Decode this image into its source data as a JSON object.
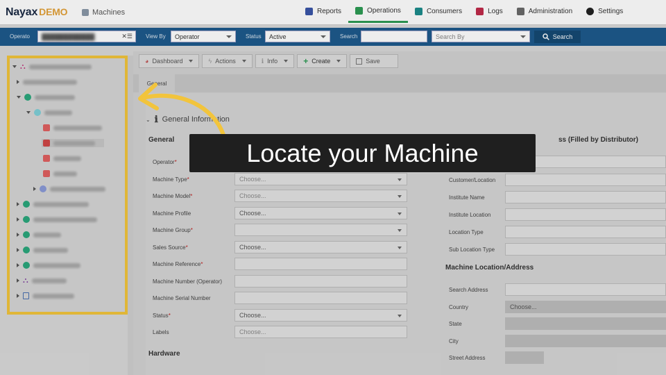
{
  "app": {
    "logo_main": "Nayax",
    "logo_sub": "DEMO",
    "page": "Machines"
  },
  "nav": [
    {
      "label": "Reports",
      "color": "#3a55a8"
    },
    {
      "label": "Operations",
      "color": "#2e9b54",
      "active": true
    },
    {
      "label": "Consumers",
      "color": "#1d8c8c"
    },
    {
      "label": "Logs",
      "color": "#c02a4a"
    },
    {
      "label": "Administration",
      "color": "#6a6a6a"
    },
    {
      "label": "Settings",
      "color": "#222222"
    }
  ],
  "filters": {
    "operator_label": "Operato",
    "view_by_label": "View By",
    "view_by_value": "Operator",
    "status_label": "Status",
    "status_value": "Active",
    "search_label": "Search",
    "search_value": "",
    "search_by_placeholder": "Search By",
    "search_button": "Search"
  },
  "toolbar": {
    "dashboard": "Dashboard",
    "actions": "Actions",
    "info": "Info",
    "create": "Create",
    "save": "Save"
  },
  "tabs": {
    "general": "General"
  },
  "general_info": {
    "header": "General Information",
    "section_general": "General",
    "section_hardware": "Hardware",
    "section_location": "Machine Location/Address",
    "section_customer_suffix": "ss (Filled by Distributor)",
    "left_fields": [
      {
        "label": "Operator",
        "required": true,
        "value": "",
        "select": false
      },
      {
        "label": "Machine Type",
        "required": true,
        "value": "Choose...",
        "select": true,
        "placeholder": true
      },
      {
        "label": "Machine Model",
        "required": true,
        "value": "Choose...",
        "select": true,
        "placeholder": true
      },
      {
        "label": "Machine Profile",
        "required": false,
        "value": "Choose...",
        "select": true,
        "placeholder": false
      },
      {
        "label": "Machine Group",
        "required": true,
        "value": "",
        "select": true,
        "placeholder": false
      },
      {
        "label": "Sales Source",
        "required": true,
        "value": "Choose...",
        "select": true,
        "placeholder": false
      },
      {
        "label": "Machine Reference",
        "required": true,
        "value": "",
        "select": false
      },
      {
        "label": "Machine Number (Operator)",
        "required": false,
        "value": "",
        "select": false
      },
      {
        "label": "Machine Serial Number",
        "required": false,
        "value": "",
        "select": false
      },
      {
        "label": "Status",
        "required": true,
        "value": "Choose...",
        "select": true,
        "placeholder": false
      },
      {
        "label": "Labels",
        "required": false,
        "value": "Choose...",
        "select": false,
        "placeholder": true
      }
    ],
    "right_fields_customer": [
      {
        "label": "Customer/Location"
      },
      {
        "label": "Institute Name"
      },
      {
        "label": "Institute Location"
      },
      {
        "label": "Location Type"
      },
      {
        "label": "Sub Location Type"
      }
    ],
    "right_fields_location": [
      {
        "label": "Search Address",
        "value": ""
      },
      {
        "label": "Country",
        "value": "Choose..."
      },
      {
        "label": "State",
        "value": ""
      },
      {
        "label": "City",
        "value": ""
      },
      {
        "label": "Street Address",
        "value": ""
      }
    ]
  },
  "callout": {
    "text": "Locate your Machine",
    "arrow_color": "#f2c43c"
  }
}
